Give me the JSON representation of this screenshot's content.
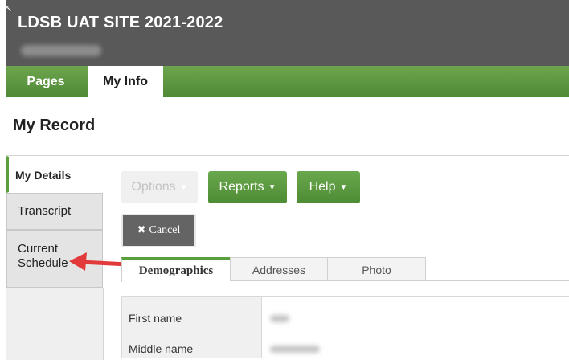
{
  "header": {
    "site_title": "LDSB UAT SITE 2021-2022",
    "cursor": "↖"
  },
  "tabs": {
    "pages": "Pages",
    "my_info": "My Info"
  },
  "page": {
    "title": "My Record"
  },
  "side_nav": {
    "items": [
      {
        "label": "My Details",
        "active": true
      },
      {
        "label": "Transcript",
        "active": false
      },
      {
        "label": "Current",
        "label2": "Schedule",
        "active": false
      }
    ]
  },
  "toolbar": {
    "options_label": "Options",
    "reports_label": "Reports",
    "help_label": "Help",
    "caret": "▼",
    "cancel_icon": "✖",
    "cancel_label": "Cancel"
  },
  "content_tabs": {
    "demographics": "Demographics",
    "addresses": "Addresses",
    "photo": "Photo"
  },
  "form": {
    "first_name_label": "First name",
    "middle_name_label": "Middle name"
  },
  "colors": {
    "header_bg": "#595959",
    "accent_green": "#5b9e3e",
    "arrow_red": "#e2393b"
  }
}
